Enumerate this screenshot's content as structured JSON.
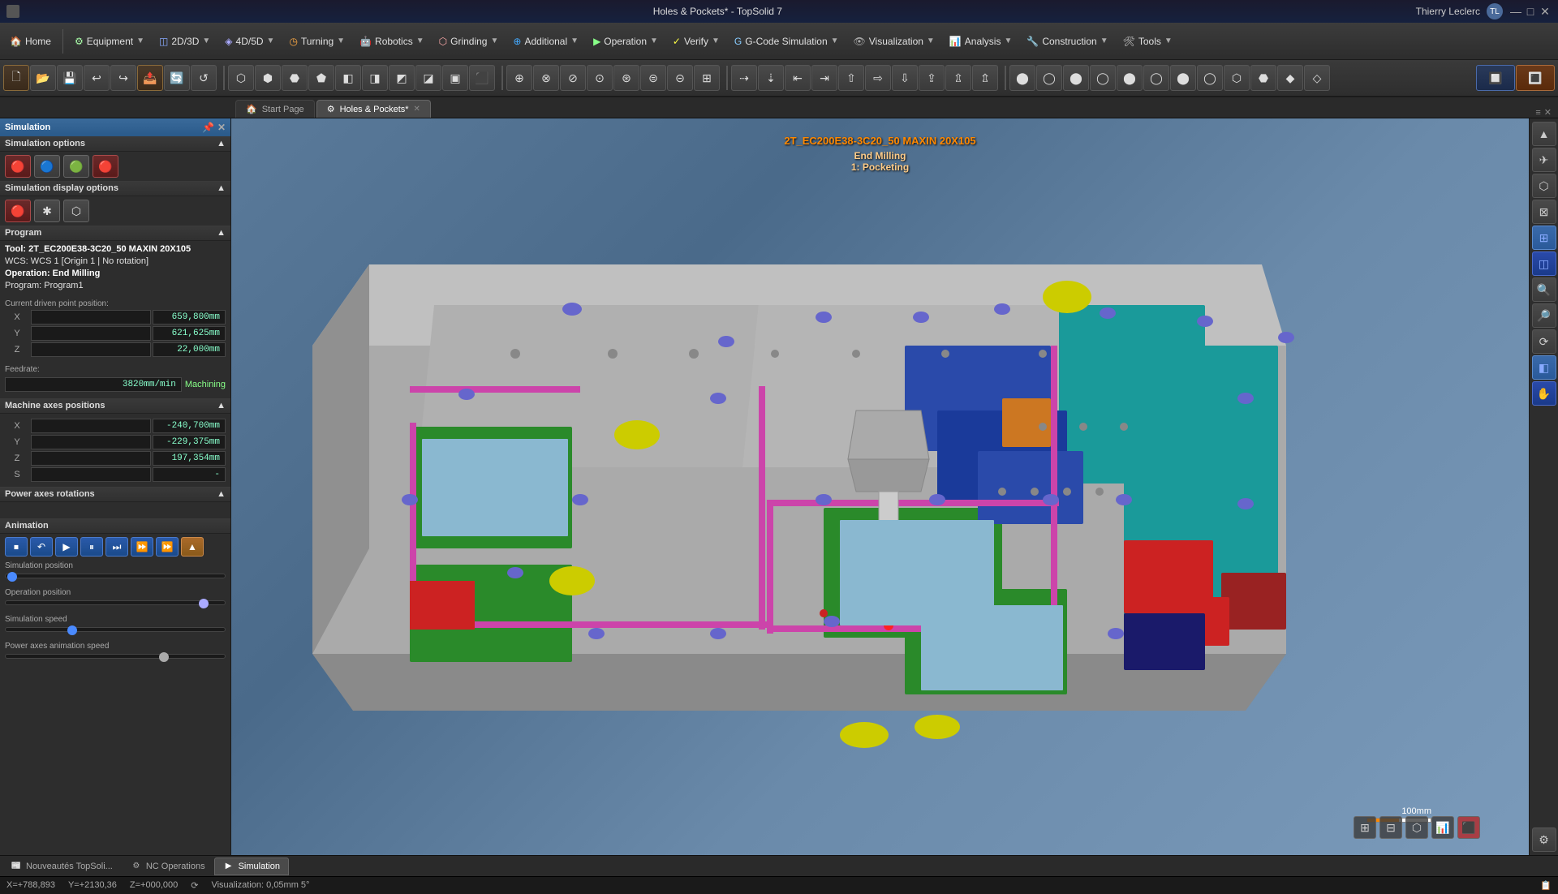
{
  "titlebar": {
    "title": "Holes & Pockets* - TopSolid 7",
    "user": "Thierry Leclerc",
    "user_initial": "TL",
    "minimize": "—",
    "maximize": "□",
    "close": "✕"
  },
  "menubar": {
    "items": [
      {
        "id": "home",
        "icon": "🏠",
        "label": "Home",
        "has_dropdown": false
      },
      {
        "id": "equipment",
        "icon": "⚙",
        "label": "Equipment",
        "has_dropdown": true
      },
      {
        "id": "2d3d",
        "icon": "◫",
        "label": "2D/3D",
        "has_dropdown": true
      },
      {
        "id": "4d5d",
        "icon": "◈",
        "label": "4D/5D",
        "has_dropdown": true
      },
      {
        "id": "turning",
        "icon": "◷",
        "label": "Turning",
        "has_dropdown": true
      },
      {
        "id": "robotics",
        "icon": "🤖",
        "label": "Robotics",
        "has_dropdown": true
      },
      {
        "id": "grinding",
        "icon": "⬡",
        "label": "Grinding",
        "has_dropdown": true
      },
      {
        "id": "additional",
        "icon": "⊕",
        "label": "Additional",
        "has_dropdown": true
      },
      {
        "id": "operation",
        "icon": "▶",
        "label": "Operation",
        "has_dropdown": true
      },
      {
        "id": "verify",
        "icon": "✓",
        "label": "Verify",
        "has_dropdown": true
      },
      {
        "id": "gcode",
        "icon": "G",
        "label": "G-Code Simulation",
        "has_dropdown": true
      },
      {
        "id": "visualization",
        "icon": "👁",
        "label": "Visualization",
        "has_dropdown": true
      },
      {
        "id": "analysis",
        "icon": "📊",
        "label": "Analysis",
        "has_dropdown": true
      },
      {
        "id": "construction",
        "icon": "🔧",
        "label": "Construction",
        "has_dropdown": true
      },
      {
        "id": "tools",
        "icon": "🛠",
        "label": "Tools",
        "has_dropdown": true
      }
    ]
  },
  "tabs": {
    "items": [
      {
        "id": "start-page",
        "label": "Start Page",
        "active": false,
        "closeable": false
      },
      {
        "id": "holes-pockets",
        "label": "Holes & Pockets*",
        "active": true,
        "closeable": true
      }
    ]
  },
  "left_panel": {
    "title": "Simulation",
    "sections": {
      "sim_options": {
        "label": "Simulation options"
      },
      "sim_display": {
        "label": "Simulation display options"
      },
      "program": {
        "label": "Program",
        "tool": "Tool: 2T_EC200E38-3C20_50 MAXIN 20X105",
        "wcs": "WCS: WCS 1 [Origin 1 | No rotation]",
        "operation": "Operation: End Milling",
        "program_name": "Program: Program1"
      },
      "driven_point": {
        "label": "Current driven point position:",
        "x_label": "X",
        "x_value": "659,800mm",
        "y_label": "Y",
        "y_value": "621,625mm",
        "z_label": "Z",
        "z_value": "22,000mm"
      },
      "feedrate": {
        "label": "Feedrate:",
        "value": "3820mm/min",
        "status": "Machining"
      },
      "machine_axes": {
        "label": "Machine axes positions",
        "x_label": "X",
        "x_value": "-240,700mm",
        "y_label": "Y",
        "y_value": "-229,375mm",
        "z_label": "Z",
        "z_value": "197,354mm",
        "s_label": "S",
        "s_value": "-"
      },
      "power_axes": {
        "label": "Power axes rotations"
      },
      "animation": {
        "label": "Animation",
        "buttons": [
          "⏹",
          "↶",
          "▶",
          "⏸",
          "⏭",
          "⏩",
          "⏩⏩"
        ],
        "speed_up": "▲"
      },
      "sim_position": {
        "label": "Simulation position",
        "value": 2
      },
      "op_position": {
        "label": "Operation position",
        "value": 88
      },
      "sim_speed": {
        "label": "Simulation speed",
        "value": 30
      },
      "power_anim_speed": {
        "label": "Power axes animation speed",
        "value": 70
      }
    }
  },
  "viewport": {
    "info_title": "2T_EC200E38-3C20_50 MAXIN 20X105",
    "info_line1": "End Milling",
    "info_line2": "1: Pocketing"
  },
  "statusbar": {
    "x": "X=+788,893",
    "y": "Y=+2130,36",
    "z": "Z=+000,000",
    "visualization": "Visualization: 0,05mm 5°"
  },
  "scale": {
    "label": "100mm"
  },
  "bottom_tabs": [
    {
      "id": "nouveautes",
      "label": "Nouveautés TopSoli...",
      "icon": "📰",
      "active": false
    },
    {
      "id": "nc-ops",
      "label": "NC Operations",
      "icon": "⚙",
      "active": false
    },
    {
      "id": "simulation",
      "label": "Simulation",
      "icon": "▶",
      "active": true
    }
  ]
}
